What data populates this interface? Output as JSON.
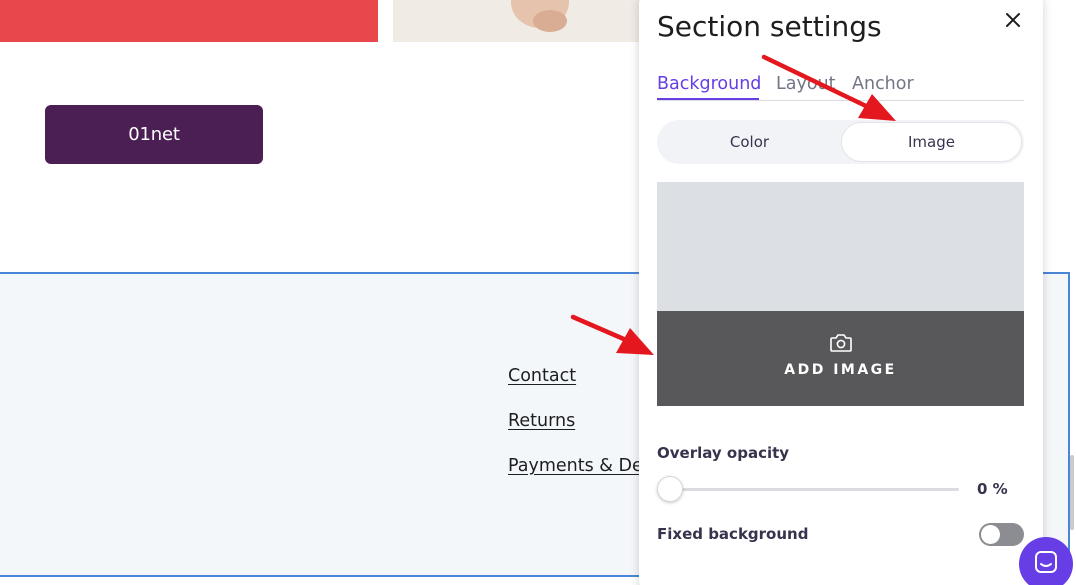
{
  "page": {
    "brand_button": "01net",
    "footer_links": [
      "Contact",
      "Returns",
      "Payments & De"
    ]
  },
  "panel": {
    "title": "Section settings",
    "tabs": [
      "Background",
      "Layout",
      "Anchor"
    ],
    "active_tab": "Background",
    "background_type": {
      "options": [
        "Color",
        "Image"
      ],
      "selected": "Image"
    },
    "add_image_label": "ADD IMAGE",
    "overlay_opacity_label": "Overlay opacity",
    "overlay_opacity_value": "0 %",
    "overlay_opacity_level": 0,
    "fixed_background_label": "Fixed background",
    "fixed_background_on": false
  },
  "icons": {
    "close": "close-icon",
    "camera": "camera-icon",
    "chat": "chat-icon"
  },
  "colors": {
    "accent": "#673de6",
    "brand_button": "#4b1f54",
    "annotation_arrow": "#e3171d",
    "add_image_bar": "#58585a",
    "footer_border": "#4a86d8"
  }
}
